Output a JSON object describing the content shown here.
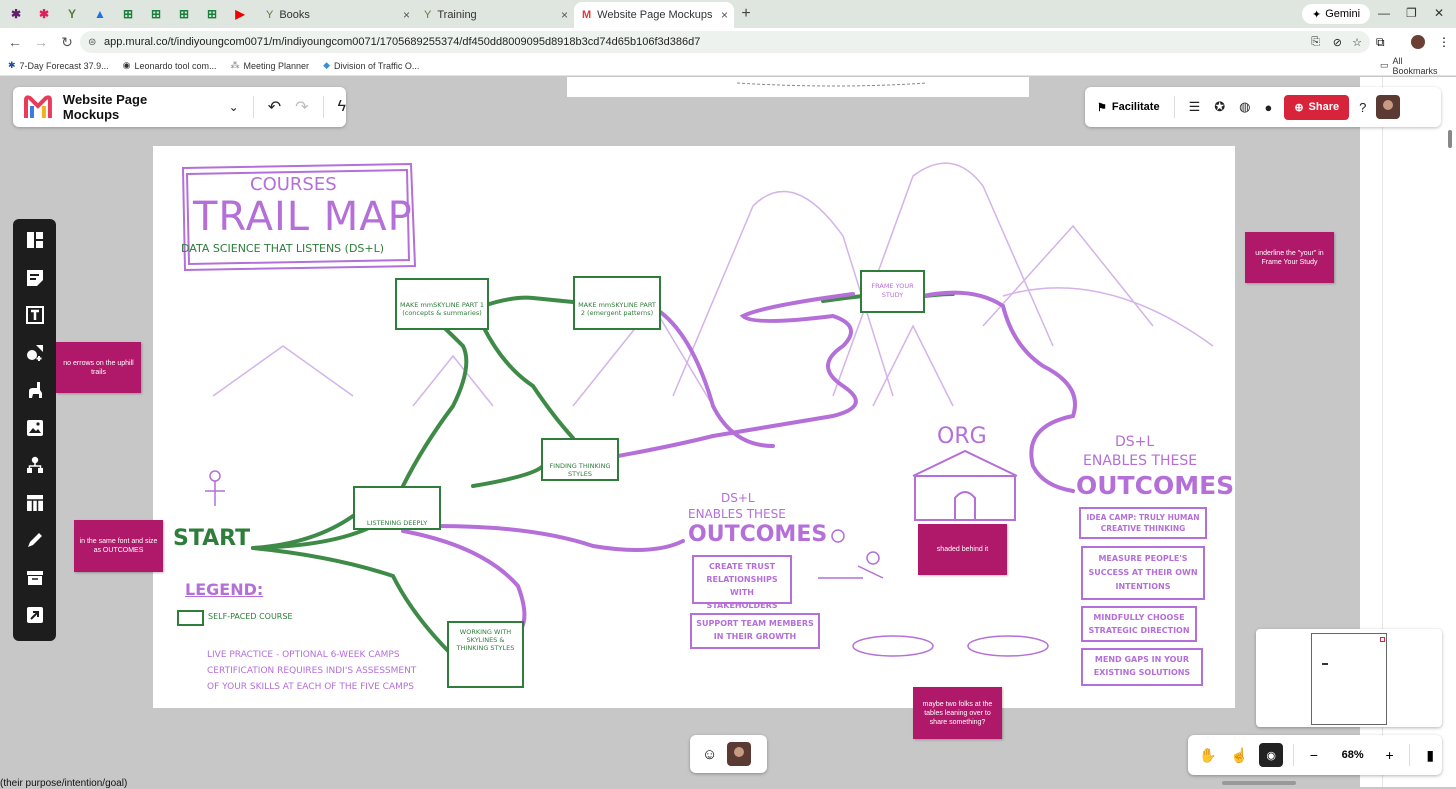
{
  "browser": {
    "tabs": [
      {
        "label": "Books"
      },
      {
        "label": "Training"
      },
      {
        "label": "Website Page Mockups • indiy"
      }
    ],
    "gemini_label": "Gemini",
    "url": "app.mural.co/t/indiyoungcom0071/m/indiyoungcom0071/1705689255374/df450dd8009095d8918b3cd74d65b106f3d386d7",
    "bookmarks": [
      {
        "label": "7-Day Forecast 37.9..."
      },
      {
        "label": "Leonardo tool com..."
      },
      {
        "label": "Meeting Planner"
      },
      {
        "label": "Division of Traffic O..."
      }
    ],
    "all_bookmarks": "All Bookmarks"
  },
  "mural": {
    "title": "Website Page Mockups",
    "facilitate": "Facilitate",
    "share": "Share",
    "zoom": "68%"
  },
  "board": {
    "header_courses": "COURSES",
    "header_trail": "TRAIL MAP",
    "subtitle": "DATA SCIENCE THAT LISTENS (DS+L)",
    "start": "START",
    "legend_title": "LEGEND:",
    "legend_course": "SELF-PACED COURSE",
    "legend_live_1": "LIVE PRACTICE - OPTIONAL 6-WEEK CAMPS",
    "legend_live_2": "CERTIFICATION REQUIRES INDI'S ASSESSMENT",
    "legend_live_3": "OF YOUR SKILLS AT EACH OF THE FIVE CAMPS",
    "courses": [
      {
        "label": "MAKE mmSKYLINE PART 1 (concepts & summaries)"
      },
      {
        "label": "MAKE mmSKYLINE PART 2 (emergent patterns)"
      },
      {
        "label": "FRAME YOUR STUDY"
      },
      {
        "label": "FINDING THINKING STYLES"
      },
      {
        "label": "LISTENING DEEPLY"
      },
      {
        "label": "WORKING WITH SKYLINES & THINKING STYLES"
      }
    ],
    "outcomes_left": {
      "pre": "DS+L",
      "mid": "ENABLES THESE",
      "title": "OUTCOMES",
      "items": [
        "CREATE TRUST RELATIONSHIPS WITH STAKEHOLDERS",
        "SUPPORT TEAM MEMBERS IN THEIR GROWTH"
      ]
    },
    "org": "ORG",
    "outcomes_right": {
      "pre": "DS+L",
      "mid": "ENABLES THESE",
      "title": "OUTCOMES",
      "items": [
        "IDEA CAMP: TRULY HUMAN CREATIVE THINKING",
        "MEASURE PEOPLE'S SUCCESS AT THEIR OWN INTENTIONS",
        "MINDFULLY CHOOSE STRATEGIC DIRECTION",
        "MEND GAPS IN YOUR EXISTING SOLUTIONS"
      ]
    }
  },
  "stickies": [
    {
      "text": "no errows on the uphill trails"
    },
    {
      "text": "in the same font and size as OUTCOMES"
    },
    {
      "text": "underline the \"your\" in Frame Your Study"
    },
    {
      "text": "shaded behind it"
    },
    {
      "text": "maybe two folks at the tables leaning over to share something?"
    }
  ],
  "bottom_text": "(their purpose/intention/goal)",
  "colors": {
    "purple": "#b46fd8",
    "green": "#2e7d3a",
    "sticky": "#b0196a",
    "share": "#d8243a"
  }
}
